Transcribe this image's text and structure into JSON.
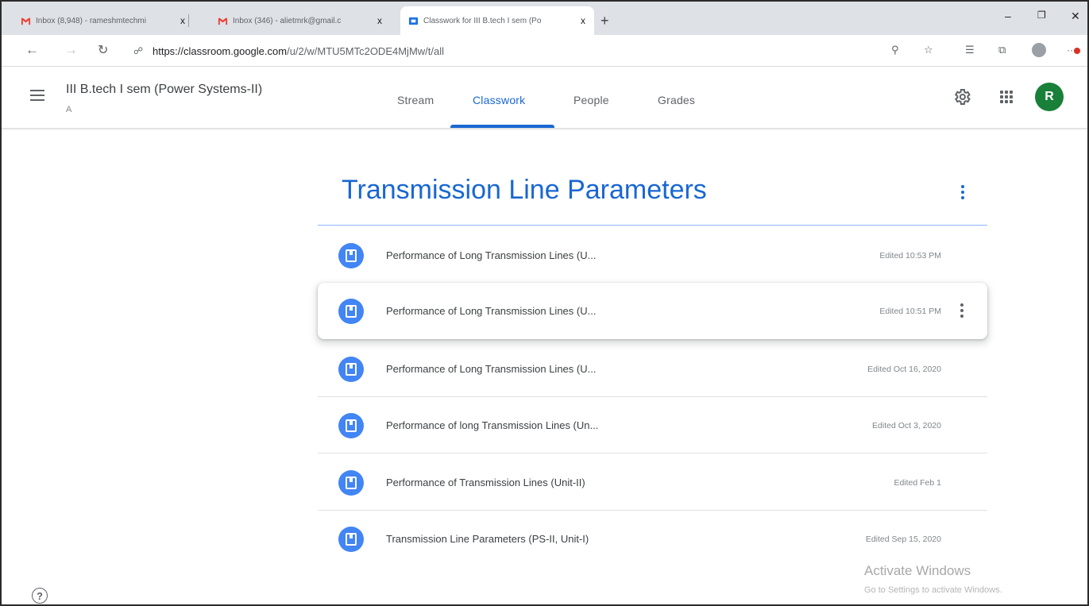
{
  "browser": {
    "tabs": [
      {
        "title": "Inbox (8,948) - rameshmtechmi",
        "icon": "gmail-icon",
        "active": false
      },
      {
        "title": "Inbox (346) - alietmrk@gmail.c",
        "icon": "gmail-icon",
        "active": false
      },
      {
        "title": "Classwork for III B.tech I sem (Po",
        "icon": "classroom-icon",
        "active": true
      }
    ],
    "new_tab": "+",
    "close_glyph": "x",
    "url_host": "https://classroom.google.com",
    "url_path": "/u/2/w/MTU5MTc2ODE4MjMw/t/all"
  },
  "header": {
    "class_title": "III B.tech I sem (Power Systems-II)",
    "class_section": "A",
    "tabs": [
      "Stream",
      "Classwork",
      "People",
      "Grades"
    ],
    "active_tab": "Classwork",
    "avatar_letter": "R",
    "accent": "#1967d2",
    "avatar_color": "#188038"
  },
  "topic": {
    "title": "Transmission Line Parameters",
    "items": [
      {
        "title": "Performance of Long Transmission Lines (U...",
        "edited": "Edited 10:53 PM"
      },
      {
        "title": "Performance of Long Transmission Lines (U...",
        "edited": "Edited 10:51 PM"
      },
      {
        "title": "Performance of Long Transmission Lines (U...",
        "edited": "Edited Oct 16, 2020"
      },
      {
        "title": "Performance of long Transmission Lines (Un...",
        "edited": "Edited Oct 3, 2020"
      },
      {
        "title": "Performance of Transmission Lines (Unit-II)",
        "edited": "Edited Feb 1"
      },
      {
        "title": "Transmission Line Parameters (PS-II, Unit-I)",
        "edited": "Edited Sep 15, 2020"
      }
    ]
  },
  "watermark": {
    "title": "Activate Windows",
    "subtitle": "Go to Settings to activate Windows."
  },
  "help_glyph": "?"
}
